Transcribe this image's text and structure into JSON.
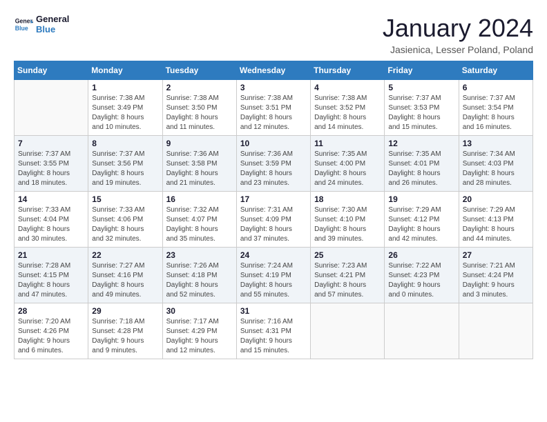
{
  "logo": {
    "line1": "General",
    "line2": "Blue"
  },
  "title": "January 2024",
  "location": "Jasienica, Lesser Poland, Poland",
  "headers": [
    "Sunday",
    "Monday",
    "Tuesday",
    "Wednesday",
    "Thursday",
    "Friday",
    "Saturday"
  ],
  "weeks": [
    [
      {
        "day": "",
        "info": ""
      },
      {
        "day": "1",
        "info": "Sunrise: 7:38 AM\nSunset: 3:49 PM\nDaylight: 8 hours\nand 10 minutes."
      },
      {
        "day": "2",
        "info": "Sunrise: 7:38 AM\nSunset: 3:50 PM\nDaylight: 8 hours\nand 11 minutes."
      },
      {
        "day": "3",
        "info": "Sunrise: 7:38 AM\nSunset: 3:51 PM\nDaylight: 8 hours\nand 12 minutes."
      },
      {
        "day": "4",
        "info": "Sunrise: 7:38 AM\nSunset: 3:52 PM\nDaylight: 8 hours\nand 14 minutes."
      },
      {
        "day": "5",
        "info": "Sunrise: 7:37 AM\nSunset: 3:53 PM\nDaylight: 8 hours\nand 15 minutes."
      },
      {
        "day": "6",
        "info": "Sunrise: 7:37 AM\nSunset: 3:54 PM\nDaylight: 8 hours\nand 16 minutes."
      }
    ],
    [
      {
        "day": "7",
        "info": "Sunrise: 7:37 AM\nSunset: 3:55 PM\nDaylight: 8 hours\nand 18 minutes."
      },
      {
        "day": "8",
        "info": "Sunrise: 7:37 AM\nSunset: 3:56 PM\nDaylight: 8 hours\nand 19 minutes."
      },
      {
        "day": "9",
        "info": "Sunrise: 7:36 AM\nSunset: 3:58 PM\nDaylight: 8 hours\nand 21 minutes."
      },
      {
        "day": "10",
        "info": "Sunrise: 7:36 AM\nSunset: 3:59 PM\nDaylight: 8 hours\nand 23 minutes."
      },
      {
        "day": "11",
        "info": "Sunrise: 7:35 AM\nSunset: 4:00 PM\nDaylight: 8 hours\nand 24 minutes."
      },
      {
        "day": "12",
        "info": "Sunrise: 7:35 AM\nSunset: 4:01 PM\nDaylight: 8 hours\nand 26 minutes."
      },
      {
        "day": "13",
        "info": "Sunrise: 7:34 AM\nSunset: 4:03 PM\nDaylight: 8 hours\nand 28 minutes."
      }
    ],
    [
      {
        "day": "14",
        "info": "Sunrise: 7:33 AM\nSunset: 4:04 PM\nDaylight: 8 hours\nand 30 minutes."
      },
      {
        "day": "15",
        "info": "Sunrise: 7:33 AM\nSunset: 4:06 PM\nDaylight: 8 hours\nand 32 minutes."
      },
      {
        "day": "16",
        "info": "Sunrise: 7:32 AM\nSunset: 4:07 PM\nDaylight: 8 hours\nand 35 minutes."
      },
      {
        "day": "17",
        "info": "Sunrise: 7:31 AM\nSunset: 4:09 PM\nDaylight: 8 hours\nand 37 minutes."
      },
      {
        "day": "18",
        "info": "Sunrise: 7:30 AM\nSunset: 4:10 PM\nDaylight: 8 hours\nand 39 minutes."
      },
      {
        "day": "19",
        "info": "Sunrise: 7:29 AM\nSunset: 4:12 PM\nDaylight: 8 hours\nand 42 minutes."
      },
      {
        "day": "20",
        "info": "Sunrise: 7:29 AM\nSunset: 4:13 PM\nDaylight: 8 hours\nand 44 minutes."
      }
    ],
    [
      {
        "day": "21",
        "info": "Sunrise: 7:28 AM\nSunset: 4:15 PM\nDaylight: 8 hours\nand 47 minutes."
      },
      {
        "day": "22",
        "info": "Sunrise: 7:27 AM\nSunset: 4:16 PM\nDaylight: 8 hours\nand 49 minutes."
      },
      {
        "day": "23",
        "info": "Sunrise: 7:26 AM\nSunset: 4:18 PM\nDaylight: 8 hours\nand 52 minutes."
      },
      {
        "day": "24",
        "info": "Sunrise: 7:24 AM\nSunset: 4:19 PM\nDaylight: 8 hours\nand 55 minutes."
      },
      {
        "day": "25",
        "info": "Sunrise: 7:23 AM\nSunset: 4:21 PM\nDaylight: 8 hours\nand 57 minutes."
      },
      {
        "day": "26",
        "info": "Sunrise: 7:22 AM\nSunset: 4:23 PM\nDaylight: 9 hours\nand 0 minutes."
      },
      {
        "day": "27",
        "info": "Sunrise: 7:21 AM\nSunset: 4:24 PM\nDaylight: 9 hours\nand 3 minutes."
      }
    ],
    [
      {
        "day": "28",
        "info": "Sunrise: 7:20 AM\nSunset: 4:26 PM\nDaylight: 9 hours\nand 6 minutes."
      },
      {
        "day": "29",
        "info": "Sunrise: 7:18 AM\nSunset: 4:28 PM\nDaylight: 9 hours\nand 9 minutes."
      },
      {
        "day": "30",
        "info": "Sunrise: 7:17 AM\nSunset: 4:29 PM\nDaylight: 9 hours\nand 12 minutes."
      },
      {
        "day": "31",
        "info": "Sunrise: 7:16 AM\nSunset: 4:31 PM\nDaylight: 9 hours\nand 15 minutes."
      },
      {
        "day": "",
        "info": ""
      },
      {
        "day": "",
        "info": ""
      },
      {
        "day": "",
        "info": ""
      }
    ]
  ]
}
